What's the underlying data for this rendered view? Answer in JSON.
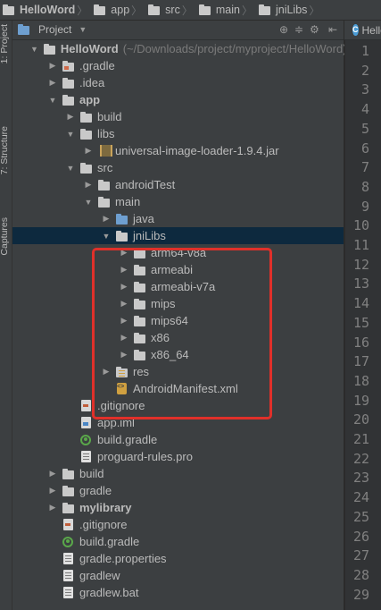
{
  "breadcrumb": [
    {
      "label": "HelloWord",
      "icon": "folder-icon"
    },
    {
      "label": "app",
      "icon": "folder-icon"
    },
    {
      "label": "src",
      "icon": "folder-icon"
    },
    {
      "label": "main",
      "icon": "folder-icon"
    },
    {
      "label": "jniLibs",
      "icon": "folder-icon"
    }
  ],
  "tool_strip": {
    "project_tab": "1: Project",
    "structure_tab": "7: Structure",
    "captures_tab": "Captures"
  },
  "panel": {
    "title": "Project",
    "view_selector_arrow": "▼"
  },
  "tree": [
    {
      "label": "HelloWord",
      "suffix": "(~/Downloads/project/myproject/HelloWord)",
      "toggle": "▼",
      "icon": "module-folder",
      "bold": true
    },
    {
      "label": ".gradle",
      "toggle": "▶",
      "icon": "folder-orange"
    },
    {
      "label": ".idea",
      "toggle": "▶",
      "icon": "folder"
    },
    {
      "label": "app",
      "toggle": "▼",
      "icon": "module-folder",
      "bold": true
    },
    {
      "label": "build",
      "toggle": "▶",
      "icon": "folder"
    },
    {
      "label": "libs",
      "toggle": "▼",
      "icon": "folder"
    },
    {
      "label": "universal-image-loader-1.9.4.jar",
      "toggle": "▶",
      "icon": "jar"
    },
    {
      "label": "src",
      "toggle": "▼",
      "icon": "folder"
    },
    {
      "label": "androidTest",
      "toggle": "▶",
      "icon": "folder"
    },
    {
      "label": "main",
      "toggle": "▼",
      "icon": "folder"
    },
    {
      "label": "java",
      "toggle": "▶",
      "icon": "folder-blue"
    },
    {
      "label": "jniLibs",
      "toggle": "▼",
      "icon": "folder",
      "selected": true
    },
    {
      "label": "arm64-v8a",
      "toggle": "▶",
      "icon": "folder"
    },
    {
      "label": "armeabi",
      "toggle": "▶",
      "icon": "folder"
    },
    {
      "label": "armeabi-v7a",
      "toggle": "▶",
      "icon": "folder"
    },
    {
      "label": "mips",
      "toggle": "▶",
      "icon": "folder"
    },
    {
      "label": "mips64",
      "toggle": "▶",
      "icon": "folder"
    },
    {
      "label": "x86",
      "toggle": "▶",
      "icon": "folder"
    },
    {
      "label": "x86_64",
      "toggle": "▶",
      "icon": "folder"
    },
    {
      "label": "res",
      "toggle": "▶",
      "icon": "folder-res"
    },
    {
      "label": "AndroidManifest.xml",
      "toggle": "",
      "icon": "xml-file"
    },
    {
      "label": ".gitignore",
      "toggle": "",
      "icon": "git-file"
    },
    {
      "label": "app.iml",
      "toggle": "",
      "icon": "iml-file"
    },
    {
      "label": "build.gradle",
      "toggle": "",
      "icon": "gradle-file"
    },
    {
      "label": "proguard-rules.pro",
      "toggle": "",
      "icon": "doc-file"
    },
    {
      "label": "build",
      "toggle": "▶",
      "icon": "folder"
    },
    {
      "label": "gradle",
      "toggle": "▶",
      "icon": "folder"
    },
    {
      "label": "mylibrary",
      "toggle": "▶",
      "icon": "module-folder",
      "bold": true
    },
    {
      "label": ".gitignore",
      "toggle": "",
      "icon": "git-file"
    },
    {
      "label": "build.gradle",
      "toggle": "",
      "icon": "gradle-file"
    },
    {
      "label": "gradle.properties",
      "toggle": "",
      "icon": "doc-file"
    },
    {
      "label": "gradlew",
      "toggle": "",
      "icon": "doc-file"
    },
    {
      "label": "gradlew.bat",
      "toggle": "",
      "icon": "doc-file"
    }
  ],
  "editor": {
    "tab_label": "Hello",
    "tab_badge": "C",
    "line_numbers": [
      "1",
      "2",
      "3",
      "4",
      "5",
      "6",
      "7",
      "8",
      "9",
      "10",
      "11",
      "12",
      "13",
      "14",
      "15",
      "16",
      "17",
      "18",
      "19",
      "20",
      "21",
      "22",
      "23",
      "24",
      "25",
      "26",
      "27",
      "28",
      "29"
    ]
  },
  "colors": {
    "highlight_box": "#e0302a",
    "selection": "#0d293e",
    "background": "#3c3f41"
  }
}
